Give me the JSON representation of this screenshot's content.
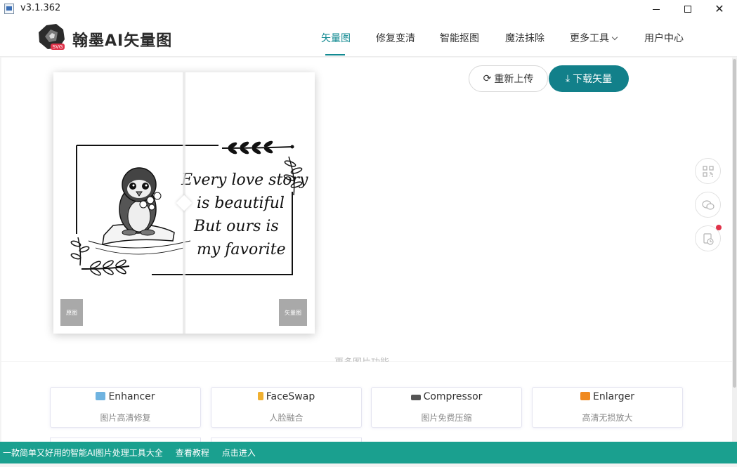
{
  "window": {
    "version": "v3.1.362",
    "minimize": "—",
    "maximize": "☐",
    "close": "✕"
  },
  "header": {
    "brand": "翰墨AI矢量图",
    "logo_badge": "SVG",
    "nav": [
      {
        "label": "矢量图",
        "active": true
      },
      {
        "label": "修复变清",
        "active": false
      },
      {
        "label": "智能抠图",
        "active": false
      },
      {
        "label": "魔法抹除",
        "active": false
      },
      {
        "label": "更多工具",
        "active": false
      },
      {
        "label": "用户中心",
        "active": false
      }
    ]
  },
  "preview": {
    "left_tag": "原图",
    "right_tag": "矢量图",
    "artwork_text": [
      "Every love story",
      "is beautiful",
      "But ours is",
      "my favorite"
    ]
  },
  "actions": {
    "reupload": "重新上传",
    "download": "下载矢量"
  },
  "side_buttons": [
    "qrcode-icon",
    "wechat-icon",
    "history-icon"
  ],
  "tools": {
    "section_label": "更多图片功能",
    "cards": [
      {
        "title": "Enhancer",
        "subtitle": "图片高清修复",
        "icon": "image-icon",
        "color": "#6fb3e0"
      },
      {
        "title": "FaceSwap",
        "subtitle": "人脸融合",
        "icon": "face-icon",
        "color": "#f0b030"
      },
      {
        "title": "Compressor",
        "subtitle": "图片免费压缩",
        "icon": "compress-icon",
        "color": "#555555"
      },
      {
        "title": "Enlarger",
        "subtitle": "高清无损放大",
        "icon": "enlarge-icon",
        "color": "#f08a20"
      }
    ]
  },
  "footer": {
    "slogan": "一款简单又好用的智能AI图片处理工具大全",
    "tutorial": "查看教程",
    "enter": "点击进入"
  },
  "colors": {
    "accent": "#128a92",
    "download_bg": "#12808a",
    "footer_bg": "#1aa08f",
    "badge_red": "#e0334a"
  }
}
